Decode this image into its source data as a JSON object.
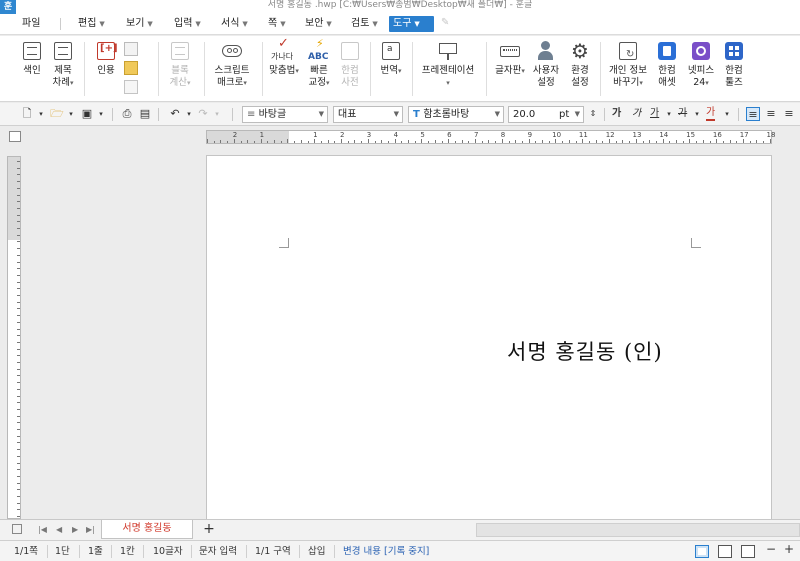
{
  "window": {
    "logo": "훈",
    "title": "서명 홍길동 .hwp [C:₩Users₩종범₩Desktop₩새 폴더₩] - 훈글"
  },
  "menu": {
    "file": "파일",
    "edit": "편집",
    "view": "보기",
    "input": "입력",
    "format": "서식",
    "page": "쪽",
    "security": "보안",
    "review": "검토",
    "tools": "도구"
  },
  "ribbon": {
    "index": [
      "색인",
      ""
    ],
    "toc": [
      "제목",
      "차례"
    ],
    "quote": [
      "인용",
      ""
    ],
    "block_calc": [
      "블록",
      "계산"
    ],
    "script_macro": [
      "스크립트",
      "매크로"
    ],
    "spelling": [
      "맞춤법",
      ""
    ],
    "quick_fix": [
      "빠른",
      "교정"
    ],
    "hanja_dict": [
      "한컴",
      "사전"
    ],
    "translate": [
      "번역",
      ""
    ],
    "presentation": [
      "프레젠테이션",
      ""
    ],
    "keyboard": [
      "글자판",
      ""
    ],
    "user_settings": [
      "사용자",
      "설정"
    ],
    "env_settings": [
      "환경",
      "설정"
    ],
    "privacy": [
      "개인 정보",
      "바꾸기"
    ],
    "hancom_assets": [
      "한컴",
      "애셋"
    ],
    "netffice": [
      "넷피스",
      "24"
    ],
    "hancom_tools": [
      "한컴",
      "툴즈"
    ],
    "spelling_icon_text": "가나다",
    "abc_icon_text": "ABC"
  },
  "format_bar": {
    "style": "바탕글",
    "lang": "대표",
    "font": "함초롬바탕",
    "size": "20.0",
    "unit": "pt",
    "bold": "가",
    "italic": "가",
    "underline": "가",
    "strike": "가",
    "color": "가"
  },
  "ruler": {
    "numbers": [
      "2",
      "1",
      "",
      "1",
      "2",
      "3",
      "4",
      "5",
      "6",
      "7",
      "8",
      "9",
      "10",
      "11",
      "12",
      "13",
      "14",
      "15",
      "16",
      "17",
      "18"
    ]
  },
  "document": {
    "text": "서명 홍길동 (인)"
  },
  "tabs": {
    "active": "서명 홍길동",
    "add": "+"
  },
  "status": {
    "page": "1/1쪽",
    "column": "1단",
    "line": "1줄",
    "cell": "1칸",
    "chars": "10글자",
    "mode": "문자 입력",
    "section": "1/1 구역",
    "insert": "삽입",
    "track_changes": "변경 내용 [기록 중지]"
  },
  "colors": {
    "accent": "#2a7fce",
    "tab_text": "#d0392b",
    "status_link": "#2a62b3"
  }
}
